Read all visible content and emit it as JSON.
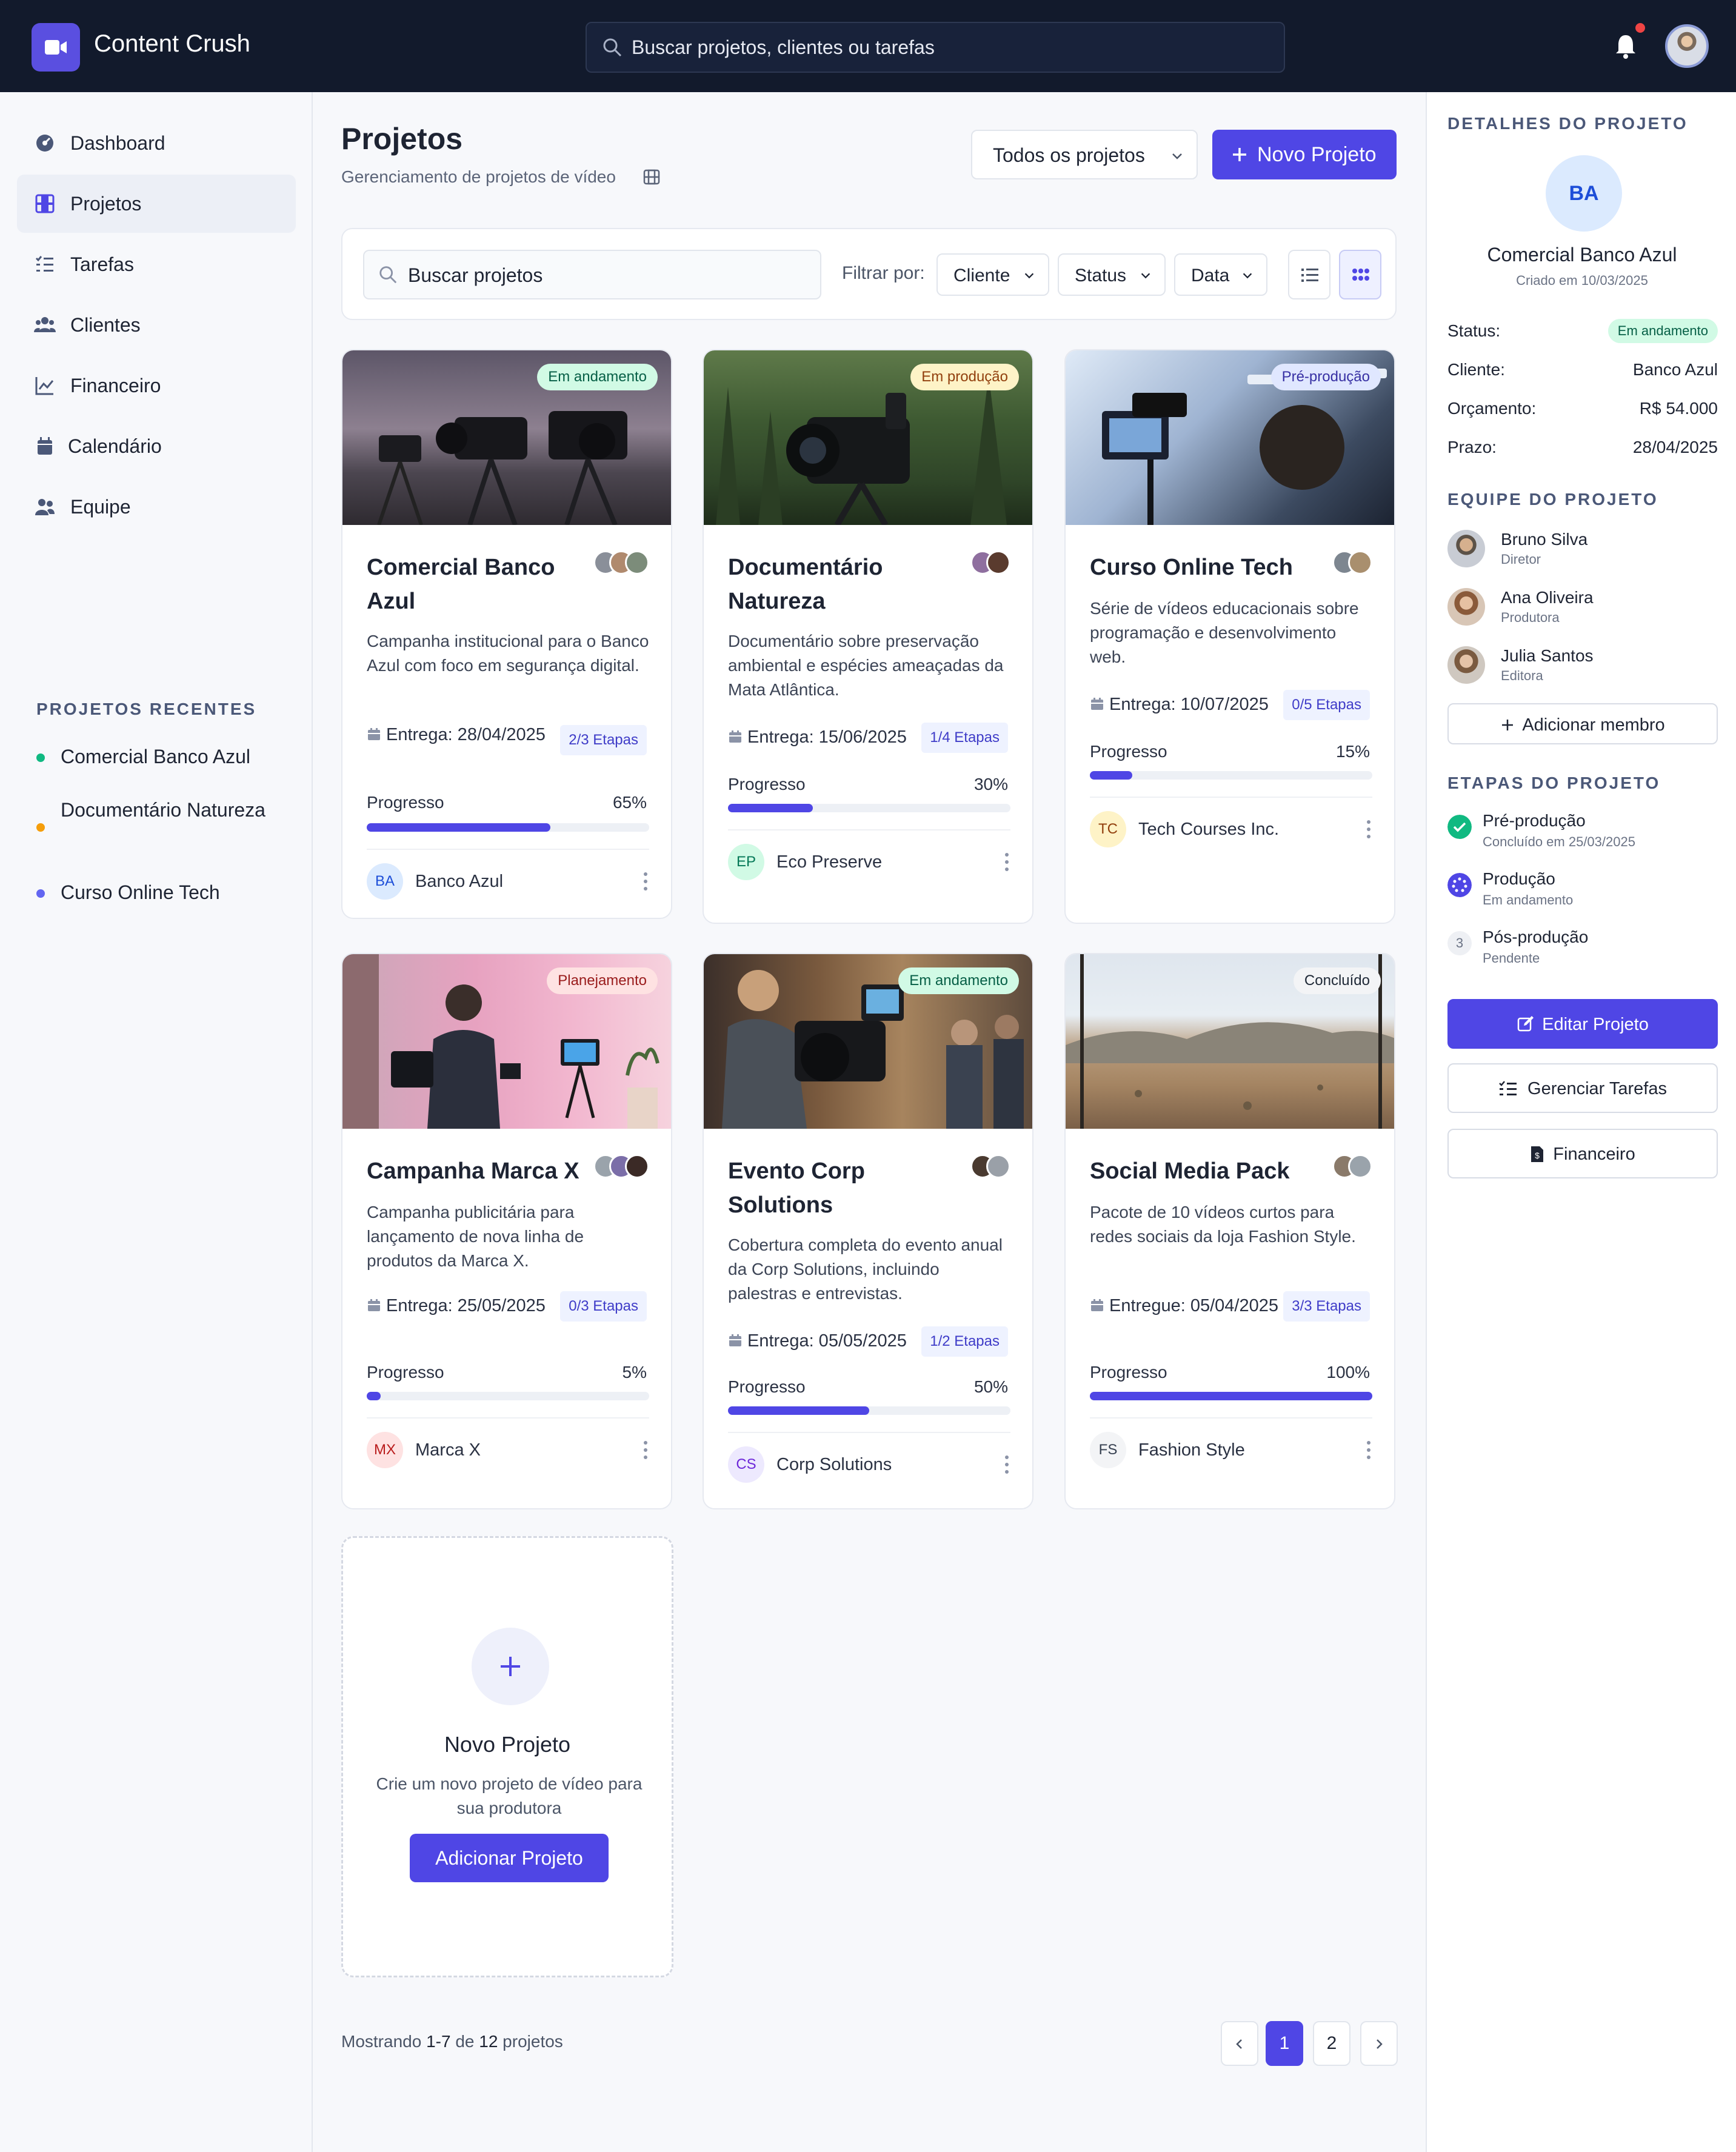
{
  "app": {
    "title": "Content Crush",
    "search_placeholder": "Buscar projetos, clientes ou tarefas"
  },
  "sidebar": {
    "items": [
      {
        "label": "Dashboard",
        "icon": "dashboard-icon"
      },
      {
        "label": "Projetos",
        "icon": "film-icon",
        "active": true
      },
      {
        "label": "Tarefas",
        "icon": "tasks-icon"
      },
      {
        "label": "Clientes",
        "icon": "users-icon"
      },
      {
        "label": "Financeiro",
        "icon": "chart-line-icon"
      },
      {
        "label": "Calendário",
        "icon": "calendar-icon"
      },
      {
        "label": "Equipe",
        "icon": "team-icon"
      }
    ],
    "recent_title": "PROJETOS RECENTES",
    "recent": [
      {
        "label": "Comercial Banco Azul",
        "color": "#10b981"
      },
      {
        "label": "Documentário Natureza",
        "color": "#f59e0b"
      },
      {
        "label": "Curso Online Tech",
        "color": "#6366f1"
      }
    ]
  },
  "main": {
    "title": "Projetos",
    "subtitle": "Gerenciamento de projetos de vídeo",
    "filter_select": "Todos os projetos",
    "new_button": "Novo Projeto",
    "search_placeholder": "Buscar projetos",
    "filter_label": "Filtrar por:",
    "filters": [
      "Cliente",
      "Status",
      "Data"
    ]
  },
  "projects": [
    {
      "title": "Comercial Banco Azul",
      "status": "Em andamento",
      "description": "Campanha institucional para o Banco Azul com foco em segurança digital.",
      "due": "Entrega: 28/04/2025",
      "steps": "2/3 Etapas",
      "progress_label": "Progresso",
      "progress_text": "65%",
      "progress": 65,
      "client_initials": "BA",
      "client": "Banco Azul"
    },
    {
      "title": "Documentário Natureza",
      "status": "Em produção",
      "description": "Documentário sobre preservação ambiental e espécies ameaçadas da Mata Atlântica.",
      "due": "Entrega: 15/06/2025",
      "steps": "1/4 Etapas",
      "progress_label": "Progresso",
      "progress_text": "30%",
      "progress": 30,
      "client_initials": "EP",
      "client": "Eco Preserve"
    },
    {
      "title": "Curso Online Tech",
      "status": "Pré-produção",
      "description": "Série de vídeos educacionais sobre programação e desenvolvimento web.",
      "due": "Entrega: 10/07/2025",
      "steps": "0/5 Etapas",
      "progress_label": "Progresso",
      "progress_text": "15%",
      "progress": 15,
      "client_initials": "TC",
      "client": "Tech Courses Inc."
    },
    {
      "title": "Campanha Marca X",
      "status": "Planejamento",
      "description": "Campanha publicitária para lançamento de nova linha de produtos da Marca X.",
      "due": "Entrega: 25/05/2025",
      "steps": "0/3 Etapas",
      "progress_label": "Progresso",
      "progress_text": "5%",
      "progress": 5,
      "client_initials": "MX",
      "client": "Marca X"
    },
    {
      "title": "Evento Corp Solutions",
      "status": "Em andamento",
      "description": "Cobertura completa do evento anual da Corp Solutions, incluindo palestras e entrevistas.",
      "due": "Entrega: 05/05/2025",
      "steps": "1/2 Etapas",
      "progress_label": "Progresso",
      "progress_text": "50%",
      "progress": 50,
      "client_initials": "CS",
      "client": "Corp Solutions"
    },
    {
      "title": "Social Media Pack",
      "status": "Concluído",
      "description": "Pacote de 10 vídeos curtos para redes sociais da loja Fashion Style.",
      "due": "Entregue: 05/04/2025",
      "steps": "3/3 Etapas",
      "progress_label": "Progresso",
      "progress_text": "100%",
      "progress": 100,
      "client_initials": "FS",
      "client": "Fashion Style"
    }
  ],
  "new_card": {
    "title": "Novo Projeto",
    "description": "Crie um novo projeto de vídeo para sua produtora",
    "button": "Adicionar Projeto"
  },
  "pagination": {
    "info_prefix": "Mostrando ",
    "range": "1-7",
    "mid": " de ",
    "total": "12",
    "suffix": " projetos",
    "pages": [
      "1",
      "2"
    ]
  },
  "details": {
    "heading": "DETALHES DO PROJETO",
    "initials": "BA",
    "name": "Comercial Banco Azul",
    "created": "Criado em 10/03/2025",
    "rows": [
      {
        "k": "Status:",
        "v": "Em andamento"
      },
      {
        "k": "Cliente:",
        "v": "Banco Azul"
      },
      {
        "k": "Orçamento:",
        "v": "R$ 54.000"
      },
      {
        "k": "Prazo:",
        "v": "28/04/2025"
      }
    ],
    "team_heading": "EQUIPE DO PROJETO",
    "team": [
      {
        "name": "Bruno Silva",
        "role": "Diretor"
      },
      {
        "name": "Ana Oliveira",
        "role": "Produtora"
      },
      {
        "name": "Julia Santos",
        "role": "Editora"
      }
    ],
    "add_member": "Adicionar membro",
    "stages_heading": "ETAPAS DO PROJETO",
    "stages": [
      {
        "name": "Pré-produção",
        "status": "Concluído em 25/03/2025"
      },
      {
        "name": "Produção",
        "status": "Em andamento"
      },
      {
        "name": "Pós-produção",
        "status": "Pendente",
        "number": "3"
      }
    ],
    "buttons": {
      "edit": "Editar Projeto",
      "tasks": "Gerenciar Tarefas",
      "finance": "Financeiro"
    }
  }
}
